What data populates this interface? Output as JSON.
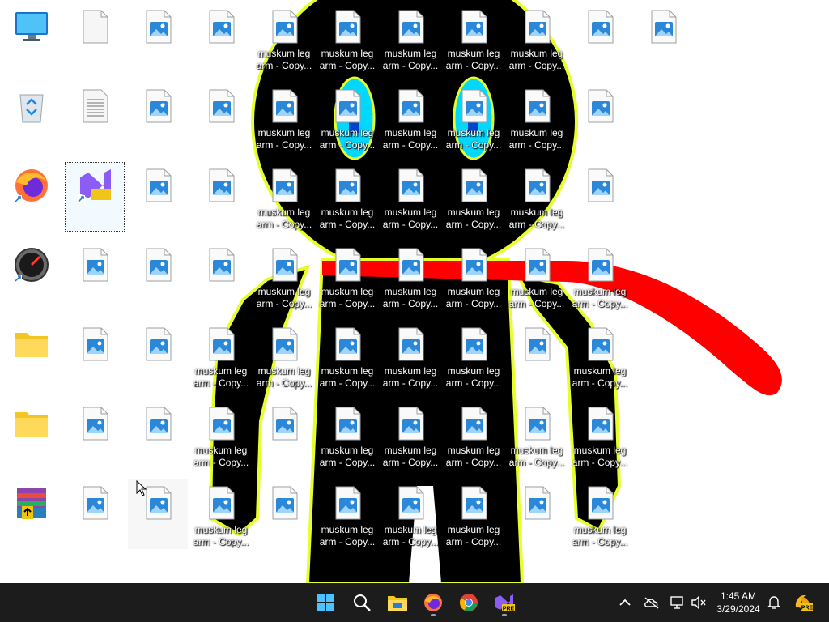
{
  "desktop": {
    "icon_label_line1": "muskum leg",
    "icon_label_line2": "arm - Copy..."
  },
  "taskbar": {
    "time": "1:45 AM",
    "date": "3/29/2024",
    "badge_pre": "PRE"
  },
  "colors": {
    "figure_fill": "#000000",
    "figure_outline": "#e6ff2a",
    "scarf": "#ff0000",
    "eye": "#00d8ff",
    "taskbar": "#1c1c1c"
  },
  "icons": {
    "image_file": "image-file-icon",
    "monitor": "this-pc-icon",
    "recycle": "recycle-bin-icon",
    "firefox": "firefox-icon",
    "speedometer": "speed-app-icon",
    "folder": "folder-icon",
    "winrar": "winrar-icon",
    "vs": "visual-studio-preview-icon"
  }
}
